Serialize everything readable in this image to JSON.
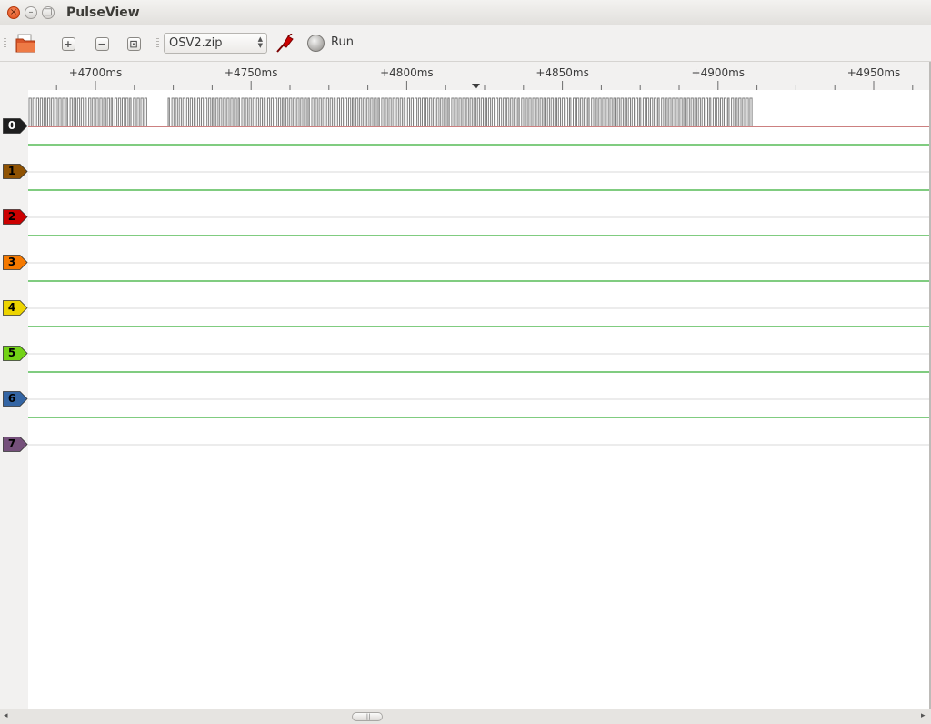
{
  "window": {
    "title": "PulseView",
    "close_glyph": "×",
    "min_glyph": "–",
    "max_glyph": "□"
  },
  "toolbar": {
    "open_icon": "folder-open-icon",
    "zoom_in_glyph": "+",
    "zoom_out_glyph": "−",
    "zoom_fit_glyph": "⊡",
    "file_selector_value": "OSV2.zip",
    "run_label": "Run"
  },
  "ruler": {
    "ticks": [
      "+4700ms",
      "+4750ms",
      "+4800ms",
      "+4850ms",
      "+4900ms",
      "+4950ms"
    ]
  },
  "channels": [
    {
      "label": "0",
      "color": "#1e1e1e",
      "text_color": "#ffffff"
    },
    {
      "label": "1",
      "color": "#8f5202",
      "text_color": "#000000"
    },
    {
      "label": "2",
      "color": "#cc0000",
      "text_color": "#000000"
    },
    {
      "label": "3",
      "color": "#f57900",
      "text_color": "#000000"
    },
    {
      "label": "4",
      "color": "#edd400",
      "text_color": "#000000"
    },
    {
      "label": "5",
      "color": "#73d216",
      "text_color": "#000000"
    },
    {
      "label": "6",
      "color": "#3465a4",
      "text_color": "#000000"
    },
    {
      "label": "7",
      "color": "#75507b",
      "text_color": "#000000"
    }
  ],
  "colors": {
    "high_level": "#009900",
    "low_level": "#990000",
    "edge": "#7f7f7f"
  },
  "scrollbar": {
    "left_arrow": "◂",
    "right_arrow": "▸",
    "thumb_grip": "|||"
  }
}
